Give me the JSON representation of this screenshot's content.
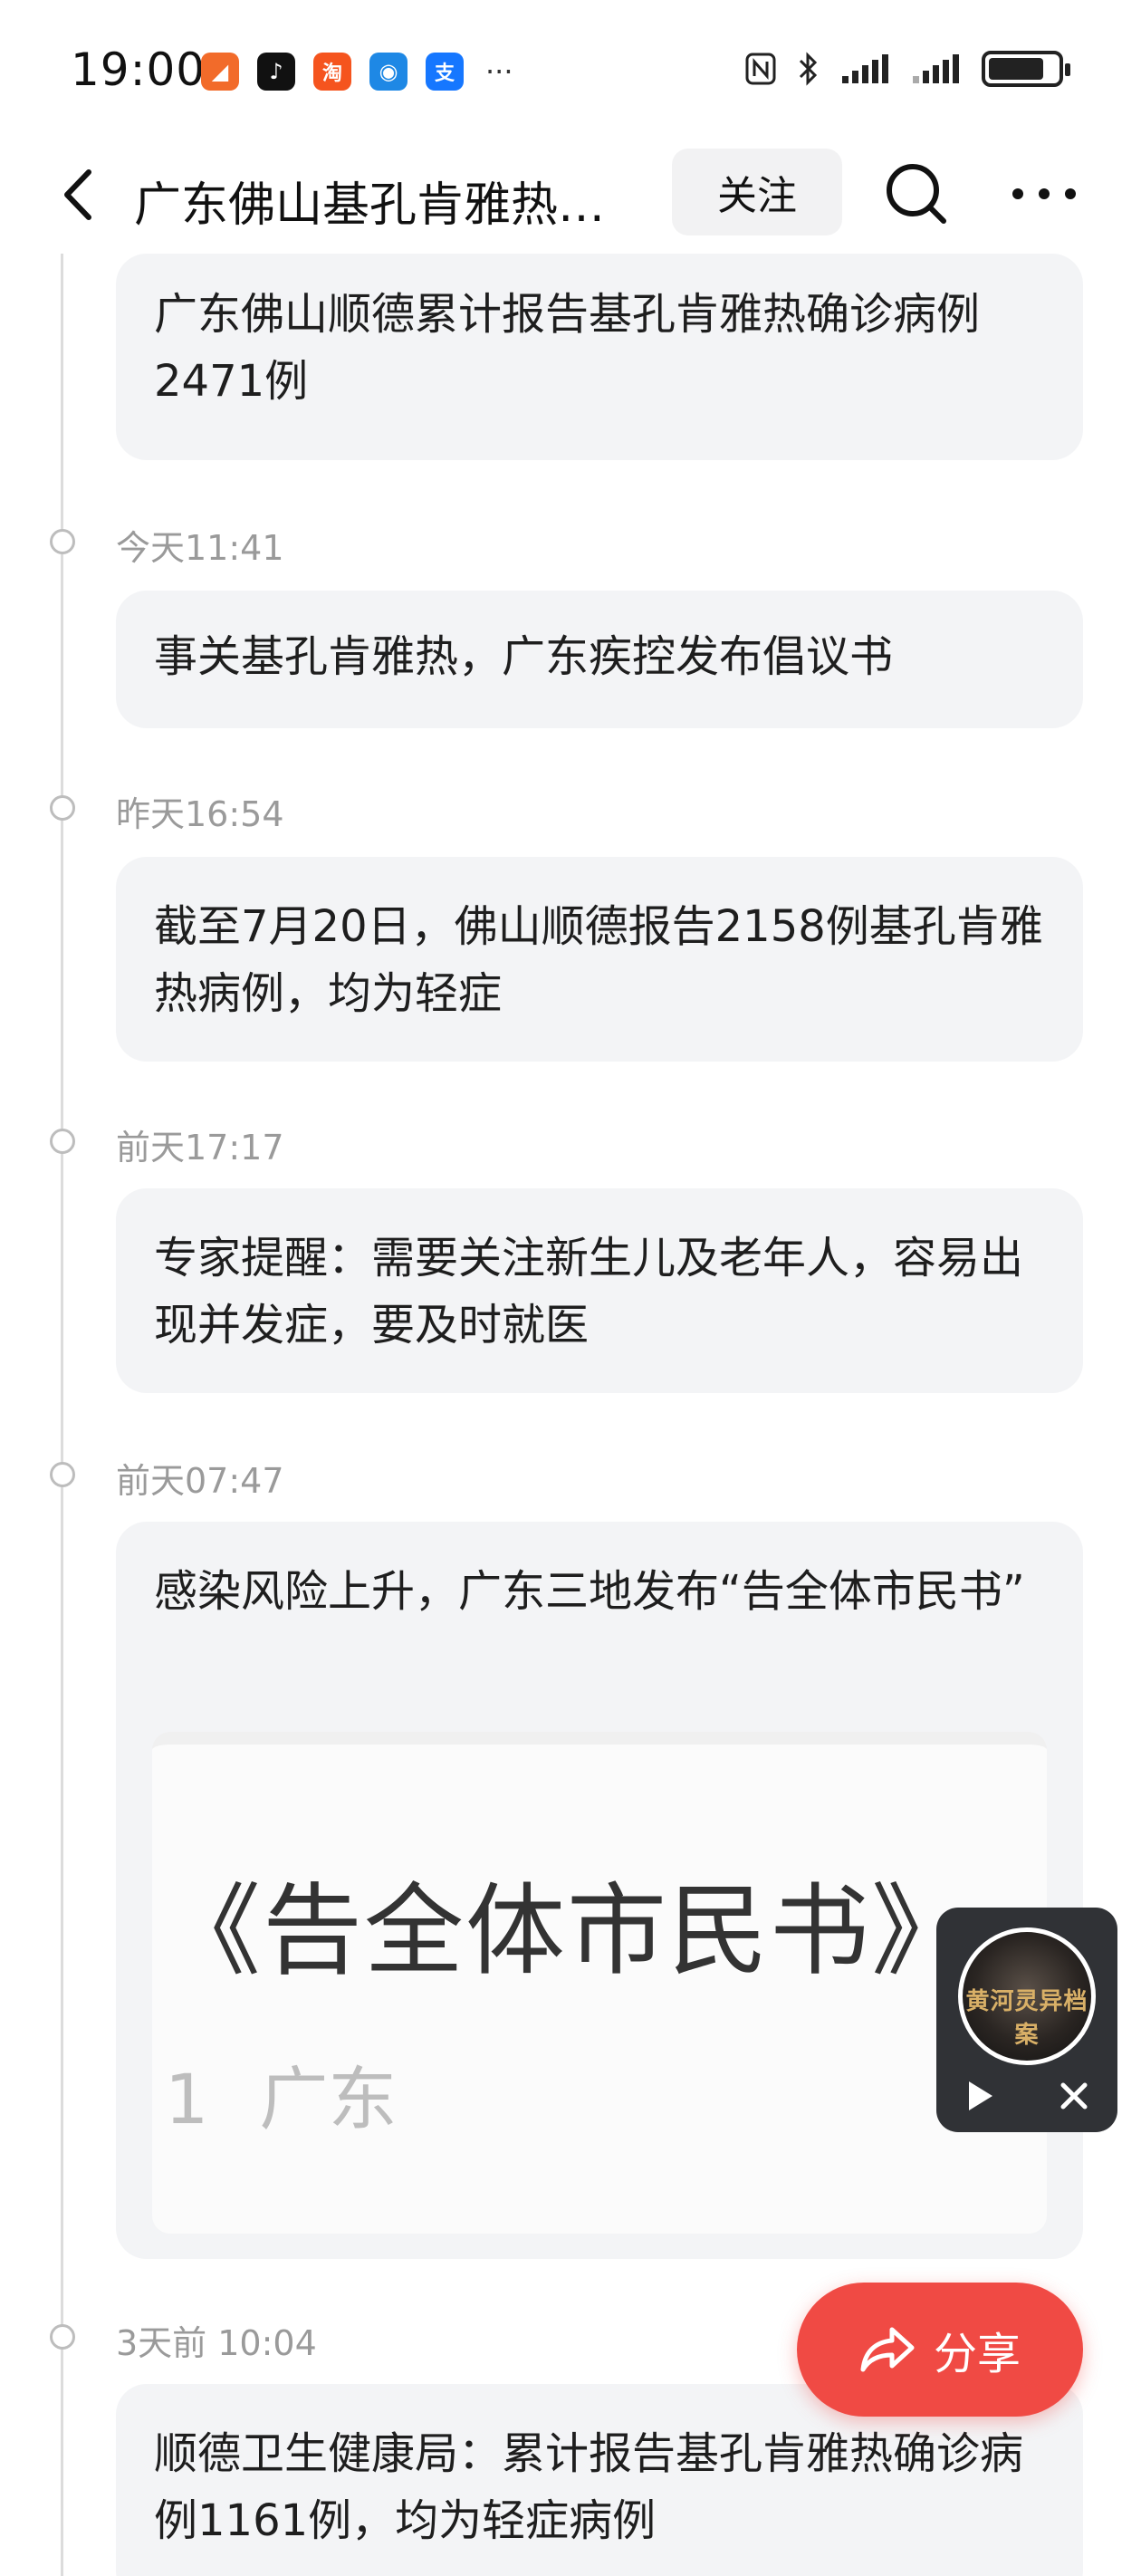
{
  "status_bar": {
    "time": "19:00",
    "apps": [
      {
        "icon": "message-app-icon",
        "color": "#f26b2a",
        "glyph": "◢"
      },
      {
        "icon": "tiktok-icon",
        "color": "#111111",
        "glyph": "♪"
      },
      {
        "icon": "taobao-icon",
        "color": "#f5541e",
        "glyph": "淘"
      },
      {
        "icon": "app-blue-icon",
        "color": "#1e88e5",
        "glyph": "◉"
      },
      {
        "icon": "alipay-icon",
        "color": "#1677ff",
        "glyph": "支"
      }
    ],
    "more": "···"
  },
  "nav": {
    "title": "广东佛山基孔肯雅热…",
    "follow_label": "关注"
  },
  "timeline": [
    {
      "time": "",
      "text": "广东佛山顺德累计报告基孔肯雅热确诊病例2471例"
    },
    {
      "time": "今天11:41",
      "text": "事关基孔肯雅热，广东疾控发布倡议书"
    },
    {
      "time": "昨天16:54",
      "text": "截至7月20日，佛山顺德报告2158例基孔肯雅热病例，均为轻症"
    },
    {
      "time": "前天17:17",
      "text": "专家提醒：需要关注新生儿及老年人，容易出现并发症，要及时就医"
    },
    {
      "time": "前天07:47",
      "text": "感染风险上升，广东三地发布“告全体市民书”",
      "image": {
        "title": "《告全体市民书》",
        "sub_num": "1",
        "sub_text": "广东"
      }
    },
    {
      "time": "3天前 10:04",
      "text": "顺德卫生健康局：累计报告基孔肯雅热确诊病例1161例，均为轻症病例"
    }
  ],
  "player": {
    "cover_text": "黄河灵异档案"
  },
  "share": {
    "label": "分享"
  },
  "colors": {
    "accent": "#f04a44",
    "card_bg": "#f3f4f6",
    "timestamp": "#9a9a9a"
  }
}
